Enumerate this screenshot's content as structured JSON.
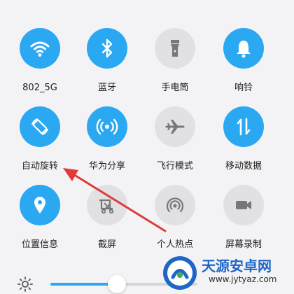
{
  "tiles": [
    {
      "label": "802_5G",
      "state": "on",
      "icon": "wifi-icon"
    },
    {
      "label": "蓝牙",
      "state": "on",
      "icon": "bluetooth-icon"
    },
    {
      "label": "手电筒",
      "state": "off",
      "icon": "flashlight-icon"
    },
    {
      "label": "响铃",
      "state": "on",
      "icon": "bell-icon"
    },
    {
      "label": "自动旋转",
      "state": "on",
      "icon": "auto-rotate-icon"
    },
    {
      "label": "华为分享",
      "state": "on",
      "icon": "share-icon"
    },
    {
      "label": "飞行模式",
      "state": "off",
      "icon": "airplane-icon"
    },
    {
      "label": "移动数据",
      "state": "on",
      "icon": "mobile-data-icon"
    },
    {
      "label": "位置信息",
      "state": "on",
      "icon": "location-icon"
    },
    {
      "label": "截屏",
      "state": "off",
      "icon": "screenshot-icon"
    },
    {
      "label": "个人热点",
      "state": "off",
      "icon": "hotspot-icon"
    },
    {
      "label": "屏幕录制",
      "state": "off",
      "icon": "screen-record-icon"
    }
  ],
  "brightness": {
    "level": 0.45,
    "icon": "sun-icon"
  },
  "colors": {
    "accent": "#2ba8f2",
    "inactive": "#e1e1e3",
    "arrow": "#e03a3a"
  },
  "watermark": {
    "title": "天源安卓网",
    "url": "www.jytyaz.com"
  }
}
